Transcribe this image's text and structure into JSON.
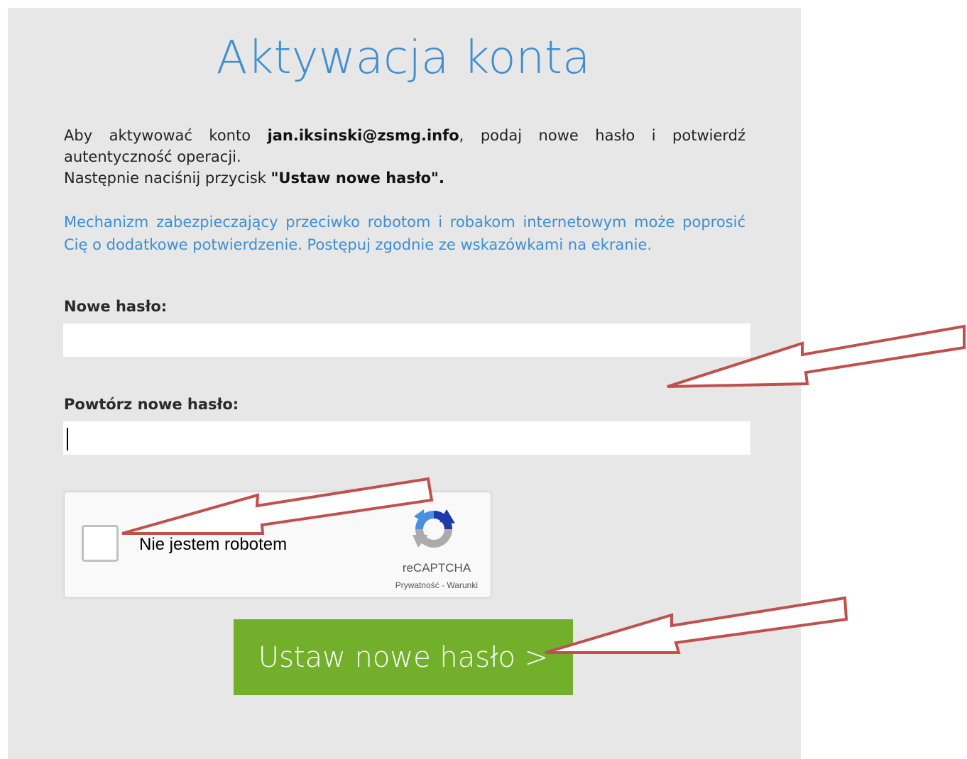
{
  "page": {
    "title": "Aktywacja konta"
  },
  "intro": {
    "prefix": "Aby aktywować konto ",
    "email": "jan.iksinski@zsmg.info",
    "suffix": ", podaj nowe hasło i potwierdź autentyczność operacji.",
    "next_prefix": "Następnie naciśnij przycisk ",
    "next_button_ref": "\"Ustaw nowe hasło\"."
  },
  "notice": "Mechanizm zabezpieczający przeciwko robotom i robakom internetowym może poprosić Cię o dodatkowe potwierdzenie. Postępuj zgodnie ze wskazówkami na ekranie.",
  "form": {
    "new_password_label": "Nowe hasło:",
    "new_password_value": "",
    "repeat_password_label": "Powtórz nowe hasło:",
    "repeat_password_value": ""
  },
  "captcha": {
    "label": "Nie jestem robotem",
    "checked": false,
    "brand": "reCAPTCHA",
    "privacy": "Prywatność",
    "separator": " - ",
    "terms": "Warunki"
  },
  "submit": {
    "label": "Ustaw nowe hasło >"
  },
  "colors": {
    "panel_bg": "#e7e7e7",
    "accent_blue": "#3d8ed2",
    "button_green": "#72b02b",
    "annotation_arrow": "#c0504d"
  },
  "icons": {
    "captcha_logo": "recaptcha-logo-icon",
    "annotation": "arrow-annotation-icon"
  }
}
